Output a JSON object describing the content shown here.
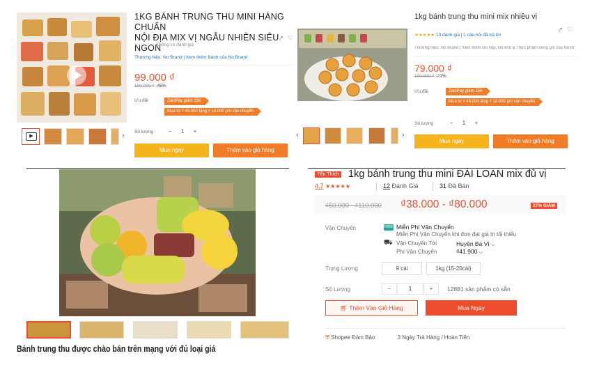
{
  "p1": {
    "title_line1": "1KG BÁNH TRUNG THU MINI HÀNG CHUẨN",
    "title_line2": "NỘI ĐỊA MIX VỊ NGẪU NHIÊN SIÊU NGON",
    "rating_text": "Không có đánh giá",
    "brand_text": "Thương hiệu: No Brand | Xem thêm Bánh của No Brand",
    "price": "99.000 ₫",
    "old_price": "190.000 ₫",
    "discount": "-45%",
    "promo_label": "Ưu đãi",
    "promo1": "ZaloPay giảm 15K",
    "promo2": "Mua từ ₫ 49.000 tặng ₫ 18.000 phí vận chuyển",
    "qty_label": "Số lượng",
    "qty_value": "1",
    "minus": "−",
    "plus": "+",
    "buy_now": "Mua ngay",
    "add_cart": "Thêm vào giỏ hàng",
    "colors": {
      "accent": "#ee4d2d",
      "buy": "#f6b31b",
      "cart": "#f07c28"
    }
  },
  "p2": {
    "title": "1kg bánh trung thu mini mix nhiều vị",
    "rating_text": "13 đánh giá | 1 câu hỏi đã trả lời",
    "brand_text": "Thương hiệu: No Brand | Xem thêm Đồ hộp, Đồ khô & Thực phẩm đóng gói của No Br...",
    "price": "79.000 ₫",
    "old_price": "100.000 ₫",
    "discount": "-21%",
    "promo_label": "Ưu đãi",
    "promo1": "ZaloPay giảm 15K",
    "promo2": "Mua từ ₫ 49.000 tặng ₫ 18.000 phí vận chuyển",
    "qty_label": "Số lượng",
    "qty_value": "1",
    "minus": "−",
    "plus": "+",
    "buy_now": "Mua ngay",
    "add_cart": "Thêm vào giỏ hàng"
  },
  "p3": {
    "badge": "Yêu Thích",
    "title": "1kg bánh trung thu mini ĐÀI LOAN mix đủ vị",
    "rating": "4.7",
    "stars": "★★★★★",
    "reviews_count": "12",
    "reviews_label": "Đánh Giá",
    "sold_count": "31",
    "sold_label": "Đã Bán",
    "old_price": "₫50.000 - ₫110.000",
    "price": "₫38.000 - ₫80.000",
    "discount": "27% GIẢM",
    "shipping_label": "Vận Chuyển",
    "freeship": "Miễn Phí Vận Chuyển",
    "freeship_note": "Miễn Phí Vận Chuyển khi đơn đạt giá trị tối thiểu",
    "ship_to_label": "Vận Chuyển Tới",
    "ship_to": "Huyện Ba Vì",
    "ship_fee_label": "Phí Vận Chuyển",
    "ship_fee": "₫41.900",
    "weight_label": "Trọng Lượng",
    "weight_opt1": "9 cái",
    "weight_opt2": "1kg (15-20cái)",
    "qty_label": "Số Lượng",
    "qty_value": "1",
    "minus": "−",
    "plus": "+",
    "stock": "12881 sản phẩm có sẵn",
    "add_cart": "Thêm Vào Giỏ Hàng",
    "buy_now": "Mua Ngay",
    "cut_text": "Shopee Đảm Bảo",
    "cut_text2": "3 Ngày Trả Hàng / Hoàn Tiền"
  },
  "caption": "Bánh trung thu được chào bán trên mạng với đủ loại giá"
}
